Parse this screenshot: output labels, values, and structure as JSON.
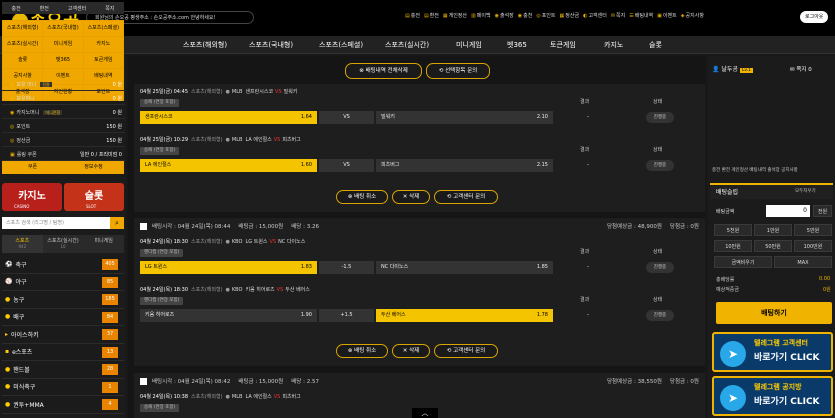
{
  "header": {
    "logo": "손오공",
    "notice": "회원님의 손오공 평생주소 : 손오공주소.com 안녕하세요!",
    "menu": [
      {
        "icon": "money-icon",
        "glyph": "▤",
        "label": "충전"
      },
      {
        "icon": "money-icon",
        "glyph": "▤",
        "label": "환전"
      },
      {
        "icon": "calc-icon",
        "glyph": "▦",
        "label": "게인정산"
      },
      {
        "icon": "pay-icon",
        "glyph": "▥",
        "label": "페이백"
      },
      {
        "icon": "coin-icon",
        "glyph": "◉",
        "label": "출석장"
      },
      {
        "icon": "coin-icon",
        "glyph": "◉",
        "label": "충천"
      },
      {
        "icon": "point-icon",
        "glyph": "◎",
        "label": "포인트"
      },
      {
        "icon": "calc-icon",
        "glyph": "▦",
        "label": "정산금"
      },
      {
        "icon": "support-icon",
        "glyph": "◐",
        "label": "고객센터"
      },
      {
        "icon": "mail-icon",
        "glyph": "✉",
        "label": "쪽지"
      },
      {
        "icon": "list-icon",
        "glyph": "☰",
        "label": "배팅내역"
      },
      {
        "icon": "event-icon",
        "glyph": "▣",
        "label": "이벤트"
      },
      {
        "icon": "notice-icon",
        "glyph": "◈",
        "label": "공지사항"
      }
    ],
    "logout": "로그아웃"
  },
  "nav": [
    "스포츠(해외형)",
    "스포츠(국내형)",
    "스포츠(스페셜)",
    "스포츠(실시간)",
    "미니게임",
    "벳365",
    "토큰게임",
    "카지노",
    "슬롯"
  ],
  "sidebar": {
    "top": [
      "충전",
      "환전",
      "고객센터",
      "쪽지"
    ],
    "grid": [
      "스포츠(해외형)",
      "스포츠(국내형)",
      "스포츠(스페셜)",
      "스포츠(실시간)",
      "미니게임",
      "카지노",
      "슬롯",
      "벳365",
      "토큰게임",
      "공지사항",
      "이벤트",
      "배팅내역",
      "출석장",
      "지인현황",
      "포인트"
    ],
    "row": [
      "쿠폰",
      "정보수정"
    ],
    "banners": [
      {
        "label": "카지노",
        "sub": "CASINO"
      },
      {
        "label": "슬롯",
        "sub": "SLOT"
      }
    ],
    "search_placeholder": "스포츠 검색 (리그명 / 팀명)",
    "tabs": [
      {
        "label": "스포츠",
        "count": "942"
      },
      {
        "label": "스포츠(실시간)",
        "count": "10"
      },
      {
        "label": "미니게임",
        "count": ""
      }
    ],
    "sports": [
      {
        "name": "축구",
        "count": "405",
        "glyph": "⚽"
      },
      {
        "name": "야구",
        "count": "85",
        "glyph": "⚾"
      },
      {
        "name": "농구",
        "count": "185",
        "glyph": "●"
      },
      {
        "name": "배구",
        "count": "84",
        "glyph": "●"
      },
      {
        "name": "아이스하키",
        "count": "37",
        "glyph": "▸"
      },
      {
        "name": "e스포츠",
        "count": "13",
        "glyph": "▪"
      },
      {
        "name": "핸드볼",
        "count": "28",
        "glyph": "●"
      },
      {
        "name": "미식축구",
        "count": "1",
        "glyph": "●"
      },
      {
        "name": "권투+MMA",
        "count": "4",
        "glyph": "●"
      }
    ]
  },
  "actions": {
    "history_delete_all": "배팅내역 전체삭제",
    "selected_inquiry": "선택항목 문의",
    "cancel": "배팅 취소",
    "delete": "삭제",
    "support_inquiry": "고객센터 문의"
  },
  "labels": {
    "result": "결과",
    "state": "상태",
    "dash": "-",
    "progress": "진행중",
    "vs": "VS"
  },
  "bets": [
    {
      "games": [
        {
          "date": "04월 25일(금) 04:45",
          "sport": "스포츠(해외형)",
          "league": "MLB",
          "home": "샌프란시스코",
          "away": "밀워키",
          "tag": "승패 (연장 포함)",
          "home_odds": "1.64",
          "draw": "VS",
          "away_odds": "2.10",
          "pick": "home"
        },
        {
          "date": "04월 25일(금) 10:29",
          "sport": "스포츠(해외형)",
          "league": "MLB",
          "home": "LA 에인절스",
          "away": "피츠버그",
          "tag": "승패 (연장 포함)",
          "home_odds": "1.60",
          "draw": "VS",
          "away_odds": "2.15",
          "pick": "home"
        }
      ]
    },
    {
      "header": {
        "bet_time": "배팅시각 : 04월 24일(목) 08:44",
        "bet_amount": "배팅금 : 15,000원",
        "bet_odds": "배당 : 3.26",
        "win_amount": "당첨예상금 : 48,900원",
        "win_paid": "당첨금 : 0원"
      },
      "games": [
        {
          "date": "04월 24일(목) 18:30",
          "sport": "스포츠(해외형)",
          "league": "KBO",
          "home": "LG 트윈스",
          "away": "NC 다이노스",
          "tag": "핸디캡 (연장 포함)",
          "home_odds": "1.83",
          "draw": "-1.5",
          "away_odds": "1.85",
          "pick": "home"
        },
        {
          "date": "04월 24일(목) 18:30",
          "sport": "스포츠(해외형)",
          "league": "KBO",
          "home": "키움 히어로즈",
          "away": "두산 베어스",
          "tag": "핸디캡 (연장 포함)",
          "home_odds": "1.90",
          "draw": "+1.5",
          "away_odds": "1.78",
          "pick": "away"
        }
      ]
    },
    {
      "header": {
        "bet_time": "배팅시각 : 04월 24일(목) 08:42",
        "bet_amount": "배팅금 : 15,000원",
        "bet_odds": "배당 : 2.57",
        "win_amount": "당첨예상금 : 38,550원",
        "win_paid": "당첨금 : 0원"
      },
      "games": [
        {
          "date": "04월 24일(목) 10:38",
          "sport": "스포츠(해외형)",
          "league": "MLB",
          "home": "LA 에인절스",
          "away": "피츠버그",
          "tag": "승패 (연장 포함)"
        }
      ]
    }
  ],
  "right_panel": {
    "user": {
      "name": "날두공",
      "level": "Lv.1",
      "msg_label": "쪽지",
      "msg_count": "0"
    },
    "rows": [
      {
        "icon": "coin-icon",
        "glyph": "◉",
        "label": "보유 머니",
        "extra": "전환",
        "value": "0 원"
      },
      {
        "icon": "coin-icon",
        "glyph": "◉",
        "label": "보유머니",
        "extra": "",
        "value": "0 원"
      },
      {
        "icon": "casino-icon",
        "glyph": "◉",
        "label": "카지노머니",
        "extra": "머니전환",
        "value": "0 원"
      },
      {
        "icon": "point-icon",
        "glyph": "◎",
        "label": "포인트",
        "extra": "",
        "value": "150 원"
      },
      {
        "icon": "calc-icon",
        "glyph": "◎",
        "label": "정산금",
        "extra": "",
        "value": "150 원"
      },
      {
        "icon": "coupon-icon",
        "glyph": "▣",
        "label": "롤링 쿠폰",
        "extra": "",
        "value": "일반 0 / 프리미엄 0"
      }
    ],
    "quicklinks": "충전  환전  게인정산  배팅내역  출석장  공지사항",
    "slip": {
      "title": "배팅슬립",
      "reset": "모두지우기",
      "amount_label": "배팅금액",
      "amount_value": "0",
      "clear": "전원",
      "chips": [
        "5천원",
        "1만원",
        "5만원",
        "10만원",
        "50만원",
        "100만원",
        "금액비우기",
        "MAX"
      ],
      "total_odds_label": "총배당률",
      "total_odds": "0.00",
      "expected_label": "예상적중금",
      "expected": "0원",
      "bet_button": "배팅하기"
    },
    "banners": [
      {
        "t1": "텔레그램 고객센터",
        "t2": "바로가기 CLICK"
      },
      {
        "t1": "텔레그램 공지방",
        "t2": "바로가기 CLICK"
      }
    ]
  },
  "colors": {
    "accent": "#f0b400",
    "selected": "#f5c400",
    "vs_red": "#ee3333"
  }
}
